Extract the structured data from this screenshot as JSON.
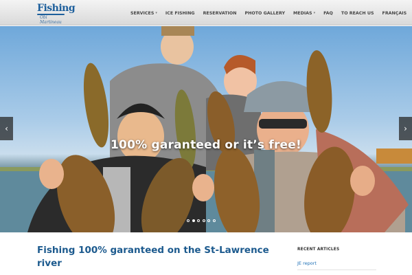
{
  "brand": {
    "logo_main": "Fishing",
    "logo_sub": "Obi Martineau",
    "colors": {
      "primary": "#1d5f9c",
      "link": "#1d6fb5",
      "nav_text": "#454545"
    }
  },
  "nav": {
    "items": [
      {
        "label": "SERVICES",
        "has_caret": "▾"
      },
      {
        "label": "ICE FISHING"
      },
      {
        "label": "RESERVATION"
      },
      {
        "label": "PHOTO GALLERY"
      },
      {
        "label": "MEDIAS",
        "has_caret": "▾"
      },
      {
        "label": "FAQ"
      },
      {
        "label": "TO REACH US"
      },
      {
        "label": "FRANÇAIS"
      }
    ]
  },
  "slider": {
    "caption": "100% garanteed or it’s free!",
    "prev_icon": "‹",
    "next_icon": "›",
    "slide_count": 6,
    "active_index": 1
  },
  "main": {
    "title": "Fishing 100% garanteed on the St-Lawrence river"
  },
  "sidebar": {
    "heading": "RECENT ARTICLES",
    "links": [
      "JE report"
    ]
  }
}
